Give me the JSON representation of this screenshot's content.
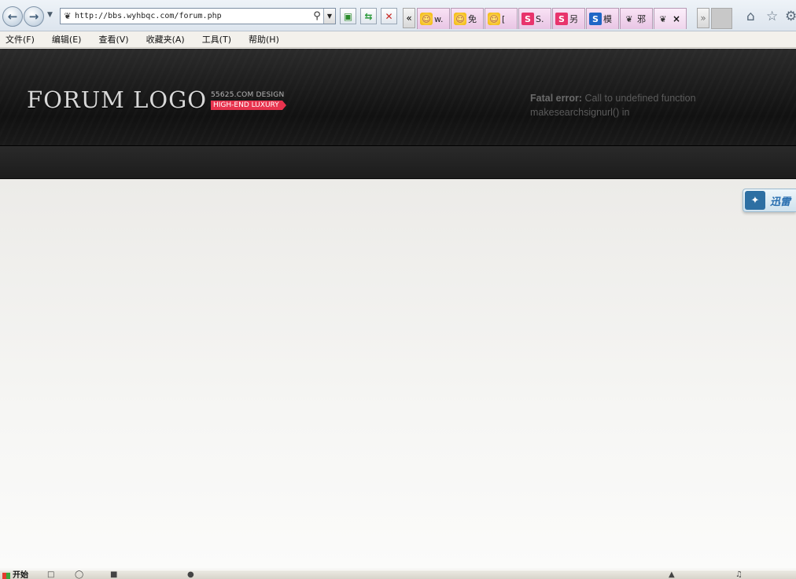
{
  "browser": {
    "address": "http://bbs.wyhbqc.com/forum.php",
    "tabs": [
      {
        "label": "w.",
        "icon": "yellow-face-icon",
        "width": 42
      },
      {
        "label": "免",
        "icon": "yellow-face-icon",
        "width": 42
      },
      {
        "label": "[",
        "icon": "yellow-face-icon",
        "width": 42
      },
      {
        "label": "S.",
        "icon": "pink-s-icon",
        "width": 42
      },
      {
        "label": "另",
        "icon": "pink-s-icon",
        "width": 42
      },
      {
        "label": "模",
        "icon": "blue-s-icon",
        "width": 42
      },
      {
        "label": "邪",
        "icon": "site-glyph-icon",
        "width": 42
      },
      {
        "label": "",
        "icon": "site-glyph-icon",
        "width": 42,
        "active": true
      }
    ],
    "menu": [
      "文件(F)",
      "编辑(E)",
      "查看(V)",
      "收藏夹(A)",
      "工具(T)",
      "帮助(H)"
    ]
  },
  "forum": {
    "logo_text": "FORUM LOGO",
    "logo_design": "55625.COM  DESIGN",
    "logo_badge": "HIGH-END LUXURY",
    "error_label": "Fatal error:",
    "error_message": "Call to undefined function makesearchsignurl() in"
  },
  "xunlei": {
    "label": "迅雷"
  },
  "taskbar": {
    "start_label": "开始"
  }
}
